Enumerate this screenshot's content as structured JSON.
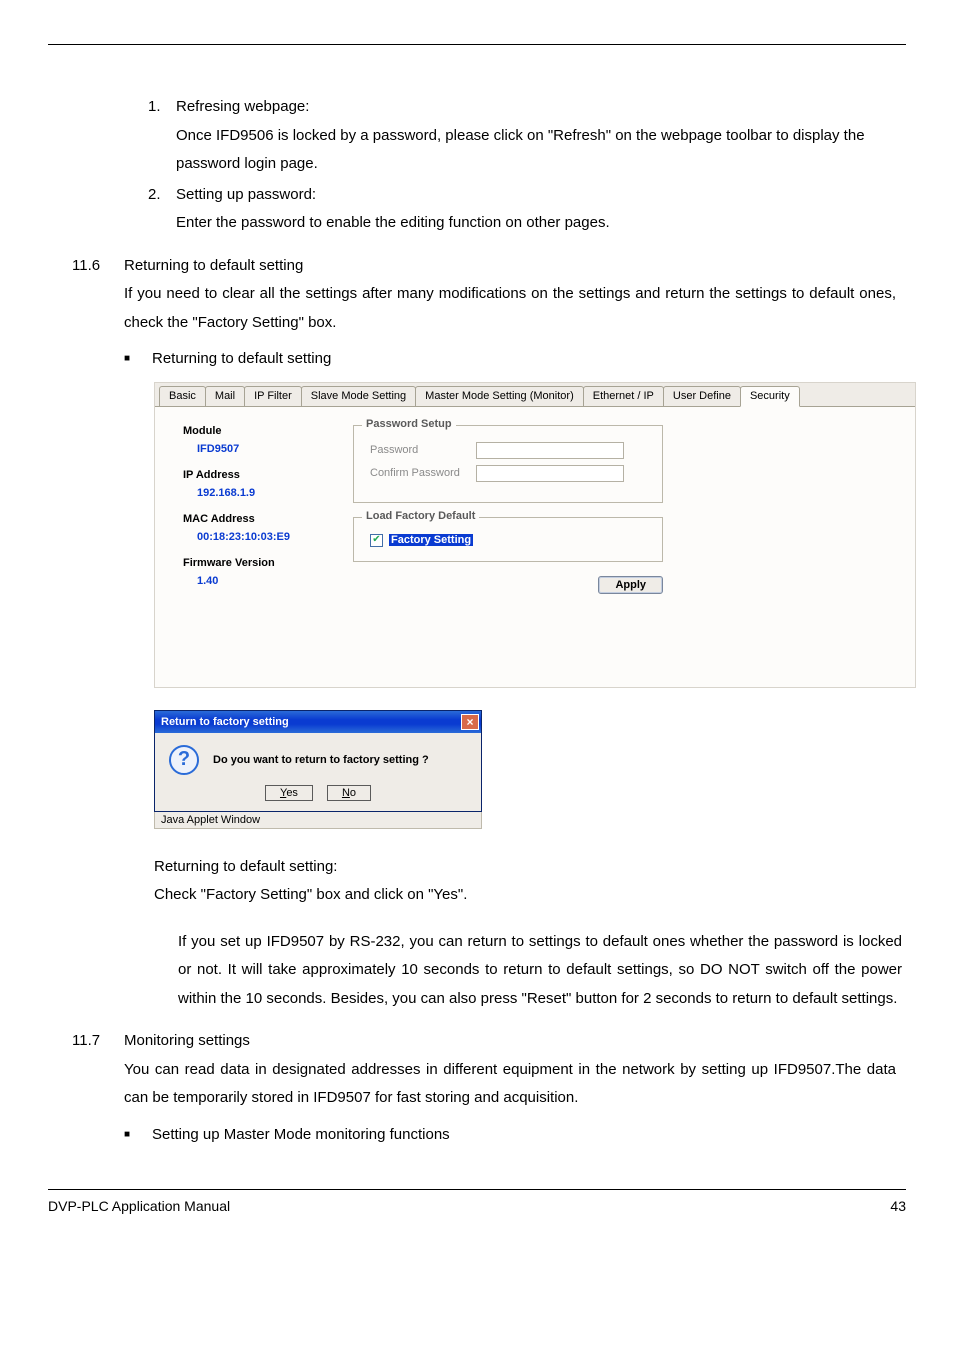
{
  "list1": {
    "items": [
      {
        "num": "1.",
        "title": "Refresing webpage:",
        "body": "Once IFD9506 is locked by a password, please click on \"Refresh\" on the webpage toolbar to display the password login page."
      },
      {
        "num": "2.",
        "title": "Setting up password:",
        "body": "Enter the password to enable the editing function on other pages."
      }
    ]
  },
  "section_116": {
    "num": "11.6",
    "title": "Returning to default setting",
    "body": "If you need to clear all the settings after many modifications on the settings and return the settings to default ones, check the \"Factory Setting\" box.",
    "bullet": "Returning to default setting"
  },
  "app": {
    "tabs": [
      "Basic",
      "Mail",
      "IP Filter",
      "Slave Mode Setting",
      "Master Mode Setting (Monitor)",
      "Ethernet / IP",
      "User Define",
      "Security"
    ],
    "active_tab_index": 7,
    "left": {
      "module_label": "Module",
      "module_value": "IFD9507",
      "ip_label": "IP Address",
      "ip_value": "192.168.1.9",
      "mac_label": "MAC Address",
      "mac_value": "00:18:23:10:03:E9",
      "fw_label": "Firmware Version",
      "fw_value": "1.40"
    },
    "password_setup": {
      "legend": "Password Setup",
      "password_label": "Password",
      "confirm_label": "Confirm Password"
    },
    "factory": {
      "legend": "Load Factory Default",
      "checkbox_label": "Factory Setting",
      "checked": true
    },
    "apply_label": "Apply"
  },
  "dialog": {
    "title": "Return to factory setting",
    "message": "Do you want to return to factory setting ?",
    "yes": "Yes",
    "no": "No",
    "status": "Java Applet Window"
  },
  "after_fig": {
    "line1": "Returning to default setting:",
    "line2": "Check \"Factory Setting\" box and click on \"Yes\".",
    "deep": "If you set up IFD9507 by RS-232, you can return to settings to default ones whether the password is locked or not. It will take approximately 10 seconds to return to default settings, so DO NOT switch off the power within the 10 seconds. Besides, you can also press \"Reset\" button for 2 seconds to return to default settings."
  },
  "section_117": {
    "num": "11.7",
    "title": "Monitoring settings",
    "body": "You can read data in designated addresses in different equipment in the network by setting up IFD9507.The data can be temporarily stored in IFD9507 for fast storing and acquisition.",
    "bullet": "Setting up Master Mode monitoring functions"
  },
  "footer": {
    "left": "DVP-PLC Application Manual",
    "right": "43"
  }
}
